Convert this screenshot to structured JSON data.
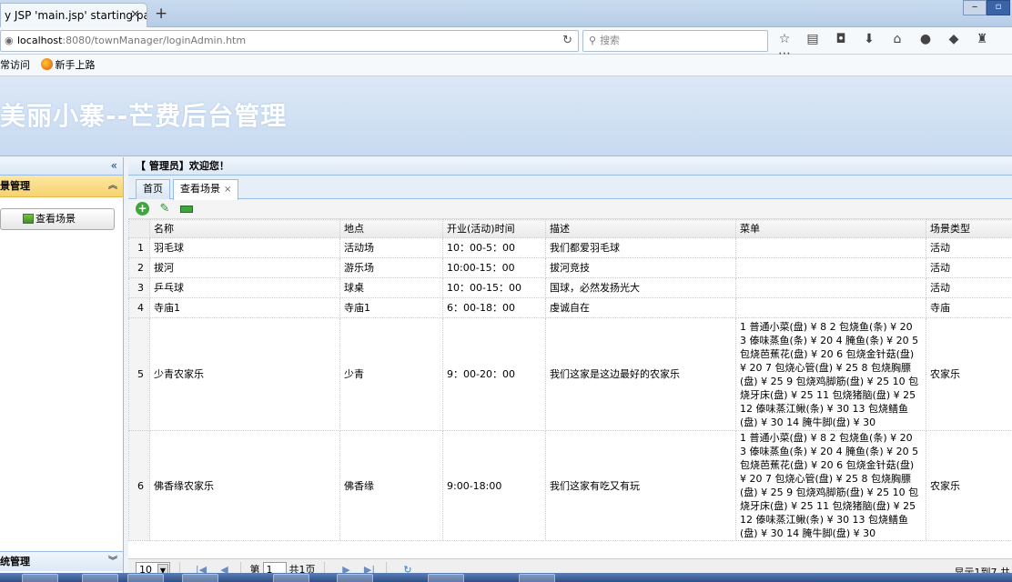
{
  "browser": {
    "tab_title": "y JSP 'main.jsp' starting pa...",
    "tab_close": "✕",
    "new_tab": "+",
    "url_host": "localhost",
    "url_rest": ":8080/townManager/loginAdmin.htm",
    "search_placeholder": "搜索",
    "bookmarks": [
      "常访问",
      "新手上路"
    ]
  },
  "app": {
    "title": "美丽小寨--芒费后台管理"
  },
  "sidebar": {
    "collapse_glyph": "«",
    "section_title": "景管理",
    "item_label": "查看场景",
    "bottom_section": "统管理"
  },
  "main": {
    "welcome": "【 管理员】欢迎您！",
    "tabs": [
      {
        "label": "首页"
      },
      {
        "label": "查看场景",
        "close": "×"
      }
    ],
    "columns": [
      "名称",
      "地点",
      "开业(活动)时间",
      "描述",
      "菜单",
      "场景类型"
    ],
    "rows": [
      {
        "n": "1",
        "name": "羽毛球",
        "place": "活动场",
        "time": "10：00-5：00",
        "desc": "我们都爱羽毛球",
        "menu": "",
        "type": "活动"
      },
      {
        "n": "2",
        "name": "拔河",
        "place": "游乐场",
        "time": "10:00-15：00",
        "desc": "拔河竞技",
        "menu": "",
        "type": "活动"
      },
      {
        "n": "3",
        "name": "乒乓球",
        "place": "球桌",
        "time": "10：00-15：00",
        "desc": "国球，必然发扬光大",
        "menu": "",
        "type": "活动"
      },
      {
        "n": "4",
        "name": "寺庙1",
        "place": "寺庙1",
        "time": "6：00-18：00",
        "desc": "虔诚自在",
        "menu": "",
        "type": "寺庙"
      },
      {
        "n": "5",
        "name": "少青农家乐",
        "place": "少青",
        "time": "9：00-20：00",
        "desc": "我们这家是这边最好的农家乐",
        "menu": "1 普通小菜(盘) ¥ 8 2 包烧鱼(条) ¥ 20 3 傣味蒸鱼(条) ¥ 20 4 腌鱼(条) ¥ 20 5 包烧芭蕉花(盘) ¥ 20 6 包烧金针菇(盘) ¥ 20 7 包烧心管(盘) ¥ 25 8 包烧胸膘(盘) ¥ 25 9 包烧鸡脚筋(盘) ¥ 25 10 包烧牙床(盘) ¥ 25 11 包烧猪脑(盘) ¥ 25 12 傣味蒸江鳅(条) ¥ 30 13 包烧鳝鱼(盘) ¥ 30 14 腌牛脚(盘) ¥ 30",
        "type": "农家乐"
      },
      {
        "n": "6",
        "name": "佛香缘农家乐",
        "place": "佛香缘",
        "time": "9:00-18:00",
        "desc": "我们这家有吃又有玩",
        "menu": "1 普通小菜(盘) ¥ 8 2 包烧鱼(条) ¥ 20 3 傣味蒸鱼(条) ¥ 20 4 腌鱼(条) ¥ 20 5 包烧芭蕉花(盘) ¥ 20 6 包烧金针菇(盘) ¥ 20 7 包烧心管(盘) ¥ 25 8 包烧胸膘(盘) ¥ 25 9 包烧鸡脚筋(盘) ¥ 25 10 包烧牙床(盘) ¥ 25 11 包烧猪脑(盘) ¥ 25 12 傣味蒸江鳅(条) ¥ 30 13 包烧鳝鱼(盘) ¥ 30 14 腌牛脚(盘) ¥ 30",
        "type": "农家乐"
      }
    ]
  },
  "pager": {
    "page_size": "10",
    "page_prefix": "第",
    "page_number": "1",
    "page_suffix": "共1页",
    "info": "显示1到7,共"
  },
  "colors": {
    "accent": "#99bbe8",
    "accordion_selected": "#f7d36f",
    "add_green": "#3da63d"
  },
  "icons": [
    "back-icon",
    "search-icon",
    "star-icon",
    "download-icon",
    "home-icon",
    "chat-icon",
    "add-icon",
    "edit-icon",
    "remove-icon",
    "first-page-icon",
    "prev-page-icon",
    "next-page-icon",
    "last-page-icon",
    "refresh-icon"
  ]
}
